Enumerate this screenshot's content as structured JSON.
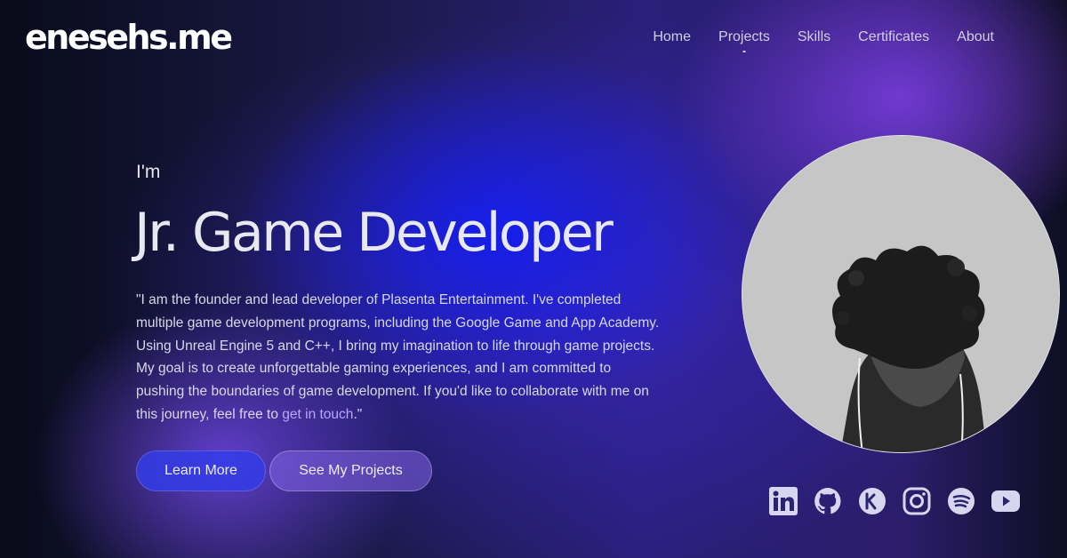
{
  "header": {
    "logo": "enesehs.me",
    "nav": [
      {
        "label": "Home"
      },
      {
        "label": "Projects"
      },
      {
        "label": "Skills"
      },
      {
        "label": "Certificates"
      },
      {
        "label": "About"
      }
    ]
  },
  "hero": {
    "intro": "I'm",
    "role": "Jr. Game Developer",
    "bio_text": "\"I am the founder and lead developer of Plasenta Entertainment. I've completed multiple game development programs, including the Google Game and App Academy. Using Unreal Engine 5 and C++, I bring my imagination to life through game projects. My goal is to create unforgettable gaming experiences, and I am committed to pushing the boundaries of game development. If you'd like to collaborate with me on this journey, feel free to ",
    "bio_link": "get in touch",
    "bio_end": ".\"",
    "buttons": {
      "learn_more": "Learn More",
      "see_projects": "See My Projects"
    }
  },
  "socials": [
    {
      "icon": "linkedin-icon"
    },
    {
      "icon": "github-icon"
    },
    {
      "icon": "kaggle-icon"
    },
    {
      "icon": "instagram-icon"
    },
    {
      "icon": "spotify-icon"
    },
    {
      "icon": "youtube-icon"
    }
  ],
  "colors": {
    "primary_button": "#323ce6",
    "accent_link": "#b9a6ff",
    "icon": "#d8d5ee"
  }
}
